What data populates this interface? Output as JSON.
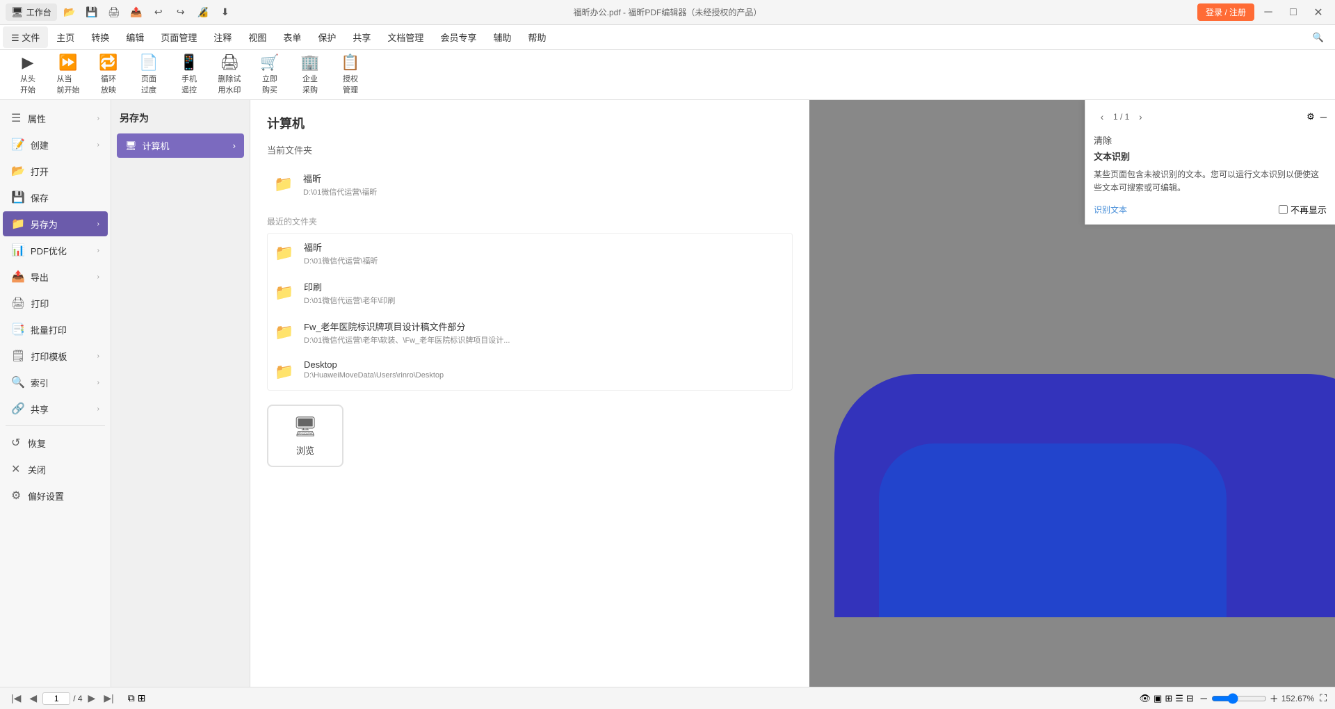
{
  "app": {
    "title": "福昕办公.pdf - 福昕PDF编辑器（未经授权的产品）",
    "login_btn": "登录 / 注册"
  },
  "titlebar": {
    "workbench": "工作台"
  },
  "menubar": {
    "items": [
      "文件",
      "主页",
      "转换",
      "编辑",
      "页面管理",
      "注释",
      "视图",
      "表单",
      "保护",
      "共享",
      "文档管理",
      "会员专享",
      "辅助",
      "帮助"
    ]
  },
  "toolbar": {
    "groups": [
      {
        "items": [
          {
            "label": "从头\n开始",
            "icon": "▶"
          },
          {
            "label": "从当\n前开始",
            "icon": "⏩"
          },
          {
            "label": "循环\n放映",
            "icon": "🔁"
          },
          {
            "label": "页面\n过度",
            "icon": "📄"
          },
          {
            "label": "手机\n遥控",
            "icon": "📱"
          },
          {
            "label": "删除试\n用水印",
            "icon": "🖨"
          },
          {
            "label": "立即\n购买",
            "icon": "🛒"
          },
          {
            "label": "企业\n采购",
            "icon": "🏢"
          },
          {
            "label": "授权\n管理",
            "icon": "📋"
          }
        ]
      }
    ],
    "sign_label": "签名"
  },
  "file_menu": {
    "items": [
      {
        "id": "properties",
        "label": "属性",
        "has_sub": true
      },
      {
        "id": "create",
        "label": "创建",
        "has_sub": true
      },
      {
        "id": "open",
        "label": "打开",
        "has_sub": false
      },
      {
        "id": "save",
        "label": "保存",
        "has_sub": false
      },
      {
        "id": "save_as",
        "label": "另存为",
        "has_sub": true,
        "active": true
      },
      {
        "id": "pdf_optimize",
        "label": "PDF优化",
        "has_sub": true
      },
      {
        "id": "export",
        "label": "导出",
        "has_sub": true
      },
      {
        "id": "print",
        "label": "打印",
        "has_sub": false
      },
      {
        "id": "batch_print",
        "label": "批量打印",
        "has_sub": false
      },
      {
        "id": "print_template",
        "label": "打印模板",
        "has_sub": true
      },
      {
        "id": "index",
        "label": "索引",
        "has_sub": true
      },
      {
        "id": "share",
        "label": "共享",
        "has_sub": true
      },
      {
        "id": "recover",
        "label": "恢复",
        "has_sub": false
      },
      {
        "id": "close",
        "label": "关闭",
        "has_sub": false
      },
      {
        "id": "preferences",
        "label": "偏好设置",
        "has_sub": false
      }
    ]
  },
  "saveas_panel": {
    "title": "另存为",
    "options": [
      {
        "id": "computer",
        "label": "计算机",
        "icon": "🖥",
        "active": true
      }
    ]
  },
  "file_browser": {
    "title": "计算机",
    "current_folder_label": "当前文件夹",
    "recent_folder_label": "最近的文件夹",
    "current_folders": [
      {
        "name": "福昕",
        "path": "D:\\01微信代运营\\福昕"
      }
    ],
    "recent_folders": [
      {
        "name": "福昕",
        "path": "D:\\01微信代运营\\福昕"
      },
      {
        "name": "印刷",
        "path": "D:\\01微信代运营\\老年\\印刷"
      },
      {
        "name": "Fw_老年医院标识牌项目设计稿文件部分",
        "path": "D:\\01微信代运营\\老年\\软装、\\Fw_老年医院标识牌项目设计..."
      },
      {
        "name": "Desktop",
        "path": "D:\\HuaweiMoveData\\Users\\rinro\\Desktop"
      }
    ],
    "browse_btn": "浏览"
  },
  "right_panel": {
    "clear_label": "清除",
    "page_info": "1 / 1",
    "ocr_title": "文本识别",
    "ocr_desc": "某些页面包含未被识别的文本。您可以运行文本识别以便使这些文本可搜索或可编辑。",
    "ocr_link": "识别文本",
    "no_show_label": "不再显示"
  },
  "statusbar": {
    "page_input": "1",
    "page_total": "/ 4",
    "zoom": "152.67%"
  }
}
